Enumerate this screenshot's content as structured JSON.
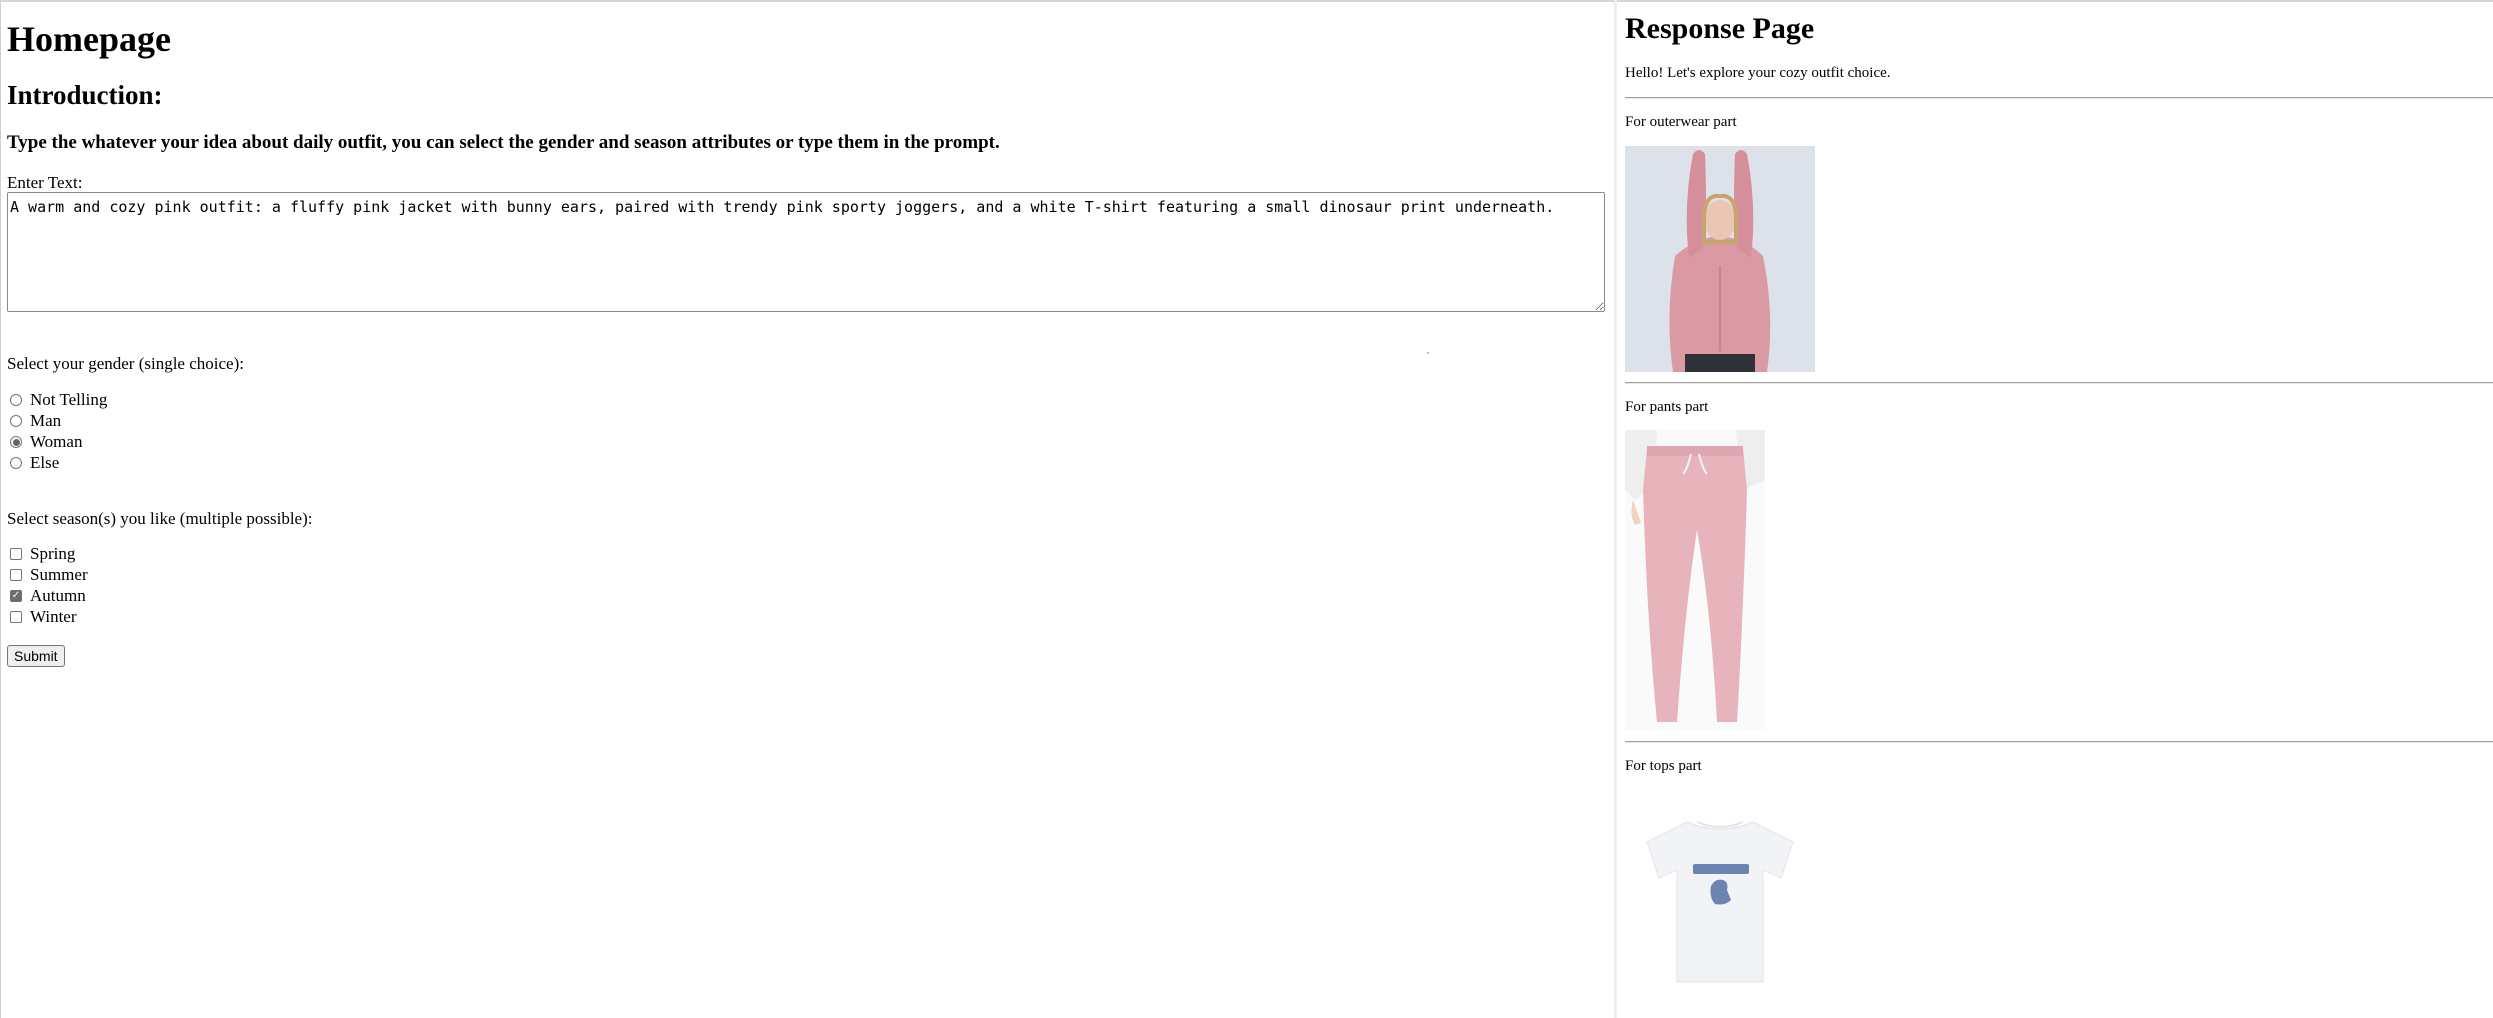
{
  "homepage": {
    "title": "Homepage",
    "intro_heading": "Introduction:",
    "instruction": "Type the whatever your idea about daily outfit, you can select the gender and season attributes or type them in the prompt.",
    "enter_label": "Enter Text:",
    "prompt_value": "A warm and cozy pink outfit: a fluffy pink jacket with bunny ears, paired with trendy pink sporty joggers, and a white T-shirt featuring a small dinosaur print underneath.",
    "gender_question": "Select your gender (single choice):",
    "gender_options": [
      {
        "label": "Not Telling",
        "checked": false
      },
      {
        "label": "Man",
        "checked": false
      },
      {
        "label": "Woman",
        "checked": true
      },
      {
        "label": "Else",
        "checked": false
      }
    ],
    "season_question": "Select season(s) you like (multiple possible):",
    "season_options": [
      {
        "label": "Spring",
        "checked": false
      },
      {
        "label": "Summer",
        "checked": false
      },
      {
        "label": "Autumn",
        "checked": true
      },
      {
        "label": "Winter",
        "checked": false
      }
    ],
    "submit_label": "Submit"
  },
  "response": {
    "title": "Response Page",
    "greeting": "Hello! Let's explore your cozy outfit choice.",
    "parts": [
      {
        "label": "For outerwear part",
        "image": "pink-bunny-ear-hoodie-photo"
      },
      {
        "label": "For pants part",
        "image": "pink-joggers-photo"
      },
      {
        "label": "For tops part",
        "image": "white-dinosaur-tshirt-photo"
      }
    ]
  }
}
